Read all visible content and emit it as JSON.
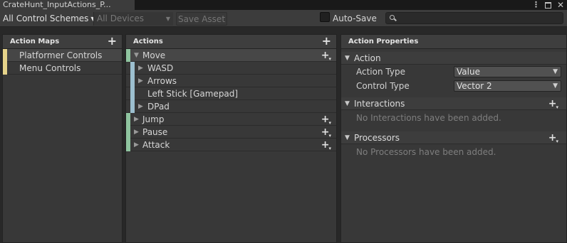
{
  "window": {
    "tab_title": "CrateHunt_InputActions_P...",
    "menu_icon": "kebab-menu-icon",
    "maximize_icon": "maximize-icon",
    "close_icon": "close-icon"
  },
  "toolbar": {
    "control_schemes": "All Control Schemes",
    "devices": "All Devices",
    "save_asset": "Save Asset",
    "auto_save_label": "Auto-Save",
    "auto_save_checked": false,
    "search_placeholder": ""
  },
  "action_maps": {
    "header": "Action Maps",
    "items": [
      {
        "label": "Platformer Controls",
        "selected": true
      },
      {
        "label": "Menu Controls",
        "selected": false
      }
    ]
  },
  "actions": {
    "header": "Actions",
    "move": "Move",
    "bindings": [
      "WASD",
      "Arrows",
      "Left Stick [Gamepad]",
      "DPad"
    ],
    "jump": "Jump",
    "pause": "Pause",
    "attack": "Attack"
  },
  "properties": {
    "header": "Action Properties",
    "action_section": "Action",
    "action_type_label": "Action Type",
    "action_type_value": "Value",
    "control_type_label": "Control Type",
    "control_type_value": "Vector 2",
    "interactions_section": "Interactions",
    "interactions_empty": "No Interactions have been added.",
    "processors_section": "Processors",
    "processors_empty": "No Processors have been added."
  },
  "colors": {
    "action_map_accent": "#e6d38a",
    "action_accent": "#8fc49f",
    "binding_accent": "#9cbfcf"
  }
}
